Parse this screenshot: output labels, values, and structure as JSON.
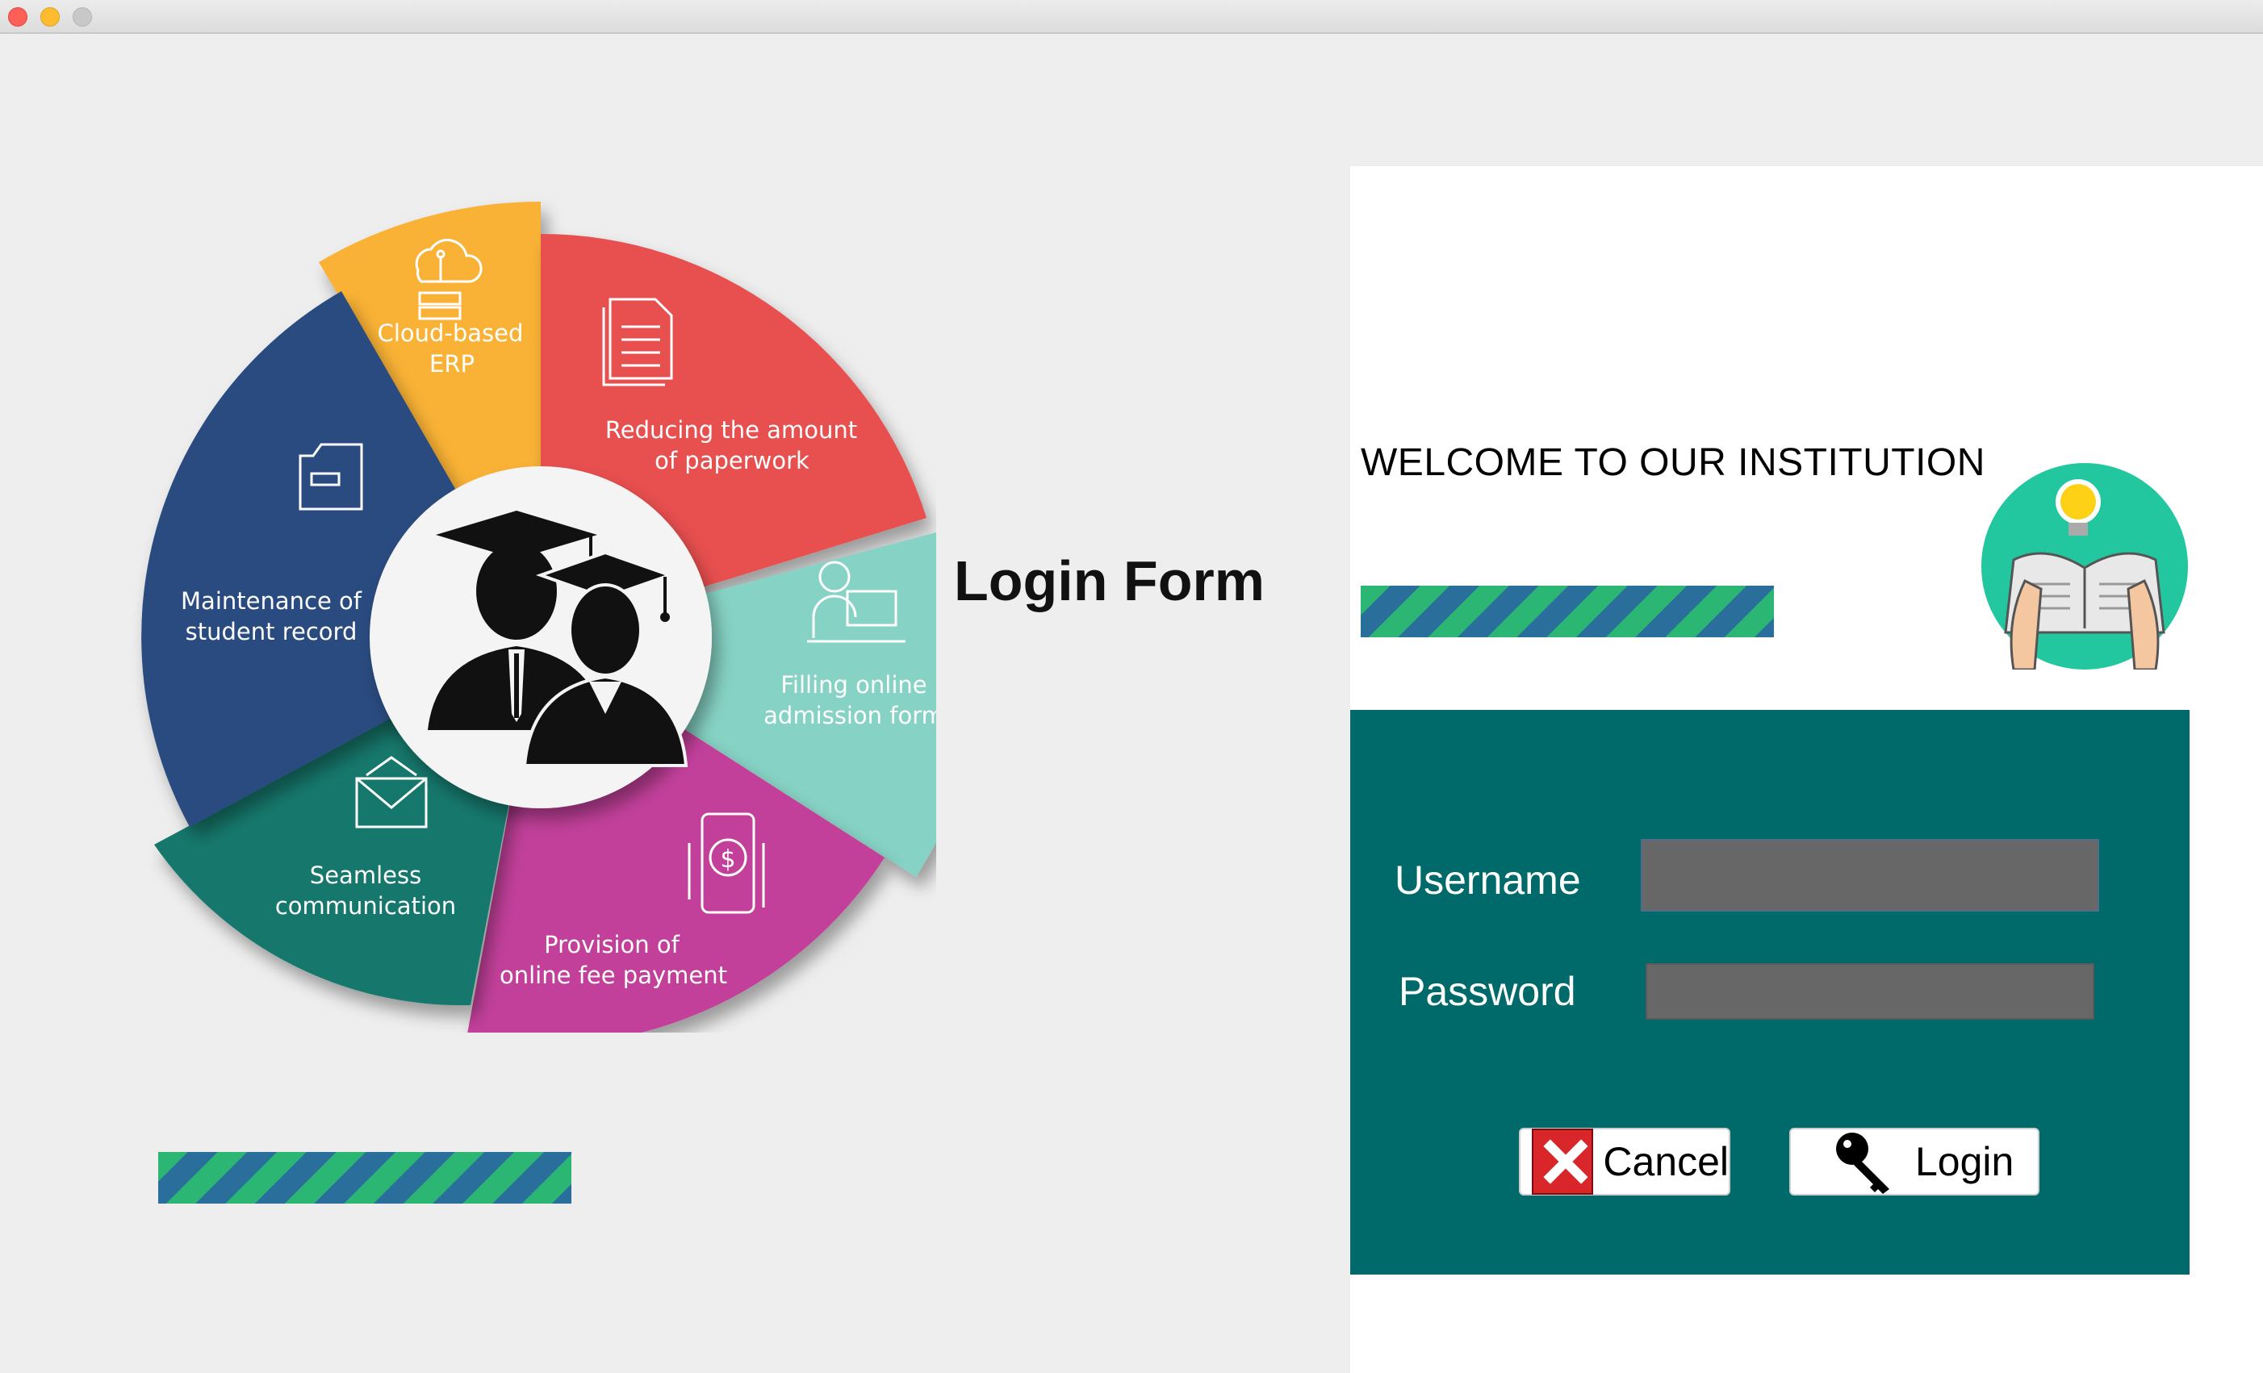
{
  "window": {
    "controls": [
      "close",
      "minimize",
      "maximize"
    ]
  },
  "wheel": {
    "segments": [
      {
        "line1": "Cloud-based",
        "line2": "ERP",
        "color": "#f9b234",
        "icon": "cloud-server-icon"
      },
      {
        "line1": "Reducing the amount",
        "line2": "of paperwork",
        "color": "#e85050",
        "icon": "document-icon"
      },
      {
        "line1": "Filling online",
        "line2": "admission form",
        "color": "#86d2c4",
        "icon": "person-at-computer-icon"
      },
      {
        "line1": "Provision of",
        "line2": "online fee payment",
        "color": "#c2409a",
        "icon": "mobile-payment-icon"
      },
      {
        "line1": "Seamless",
        "line2": "communication",
        "color": "#12786c",
        "icon": "envelope-icon"
      },
      {
        "line1": "Maintenance of",
        "line2": "student record",
        "color": "#2c4c80",
        "icon": "folder-icon"
      }
    ],
    "center_icon": "graduates-icon"
  },
  "form_title": "Login Form",
  "welcome_text": "WELCOME TO OUR INSTITUTION",
  "login": {
    "username_label": "Username",
    "password_label": "Password",
    "username_value": "",
    "password_value": "",
    "cancel_label": "Cancel",
    "login_label": "Login"
  },
  "colors": {
    "panel": "#006a6a",
    "input": "#676767",
    "stripe_green": "#2bb673",
    "stripe_blue": "#2a6f9c",
    "bulb_circle": "#22c79f"
  }
}
